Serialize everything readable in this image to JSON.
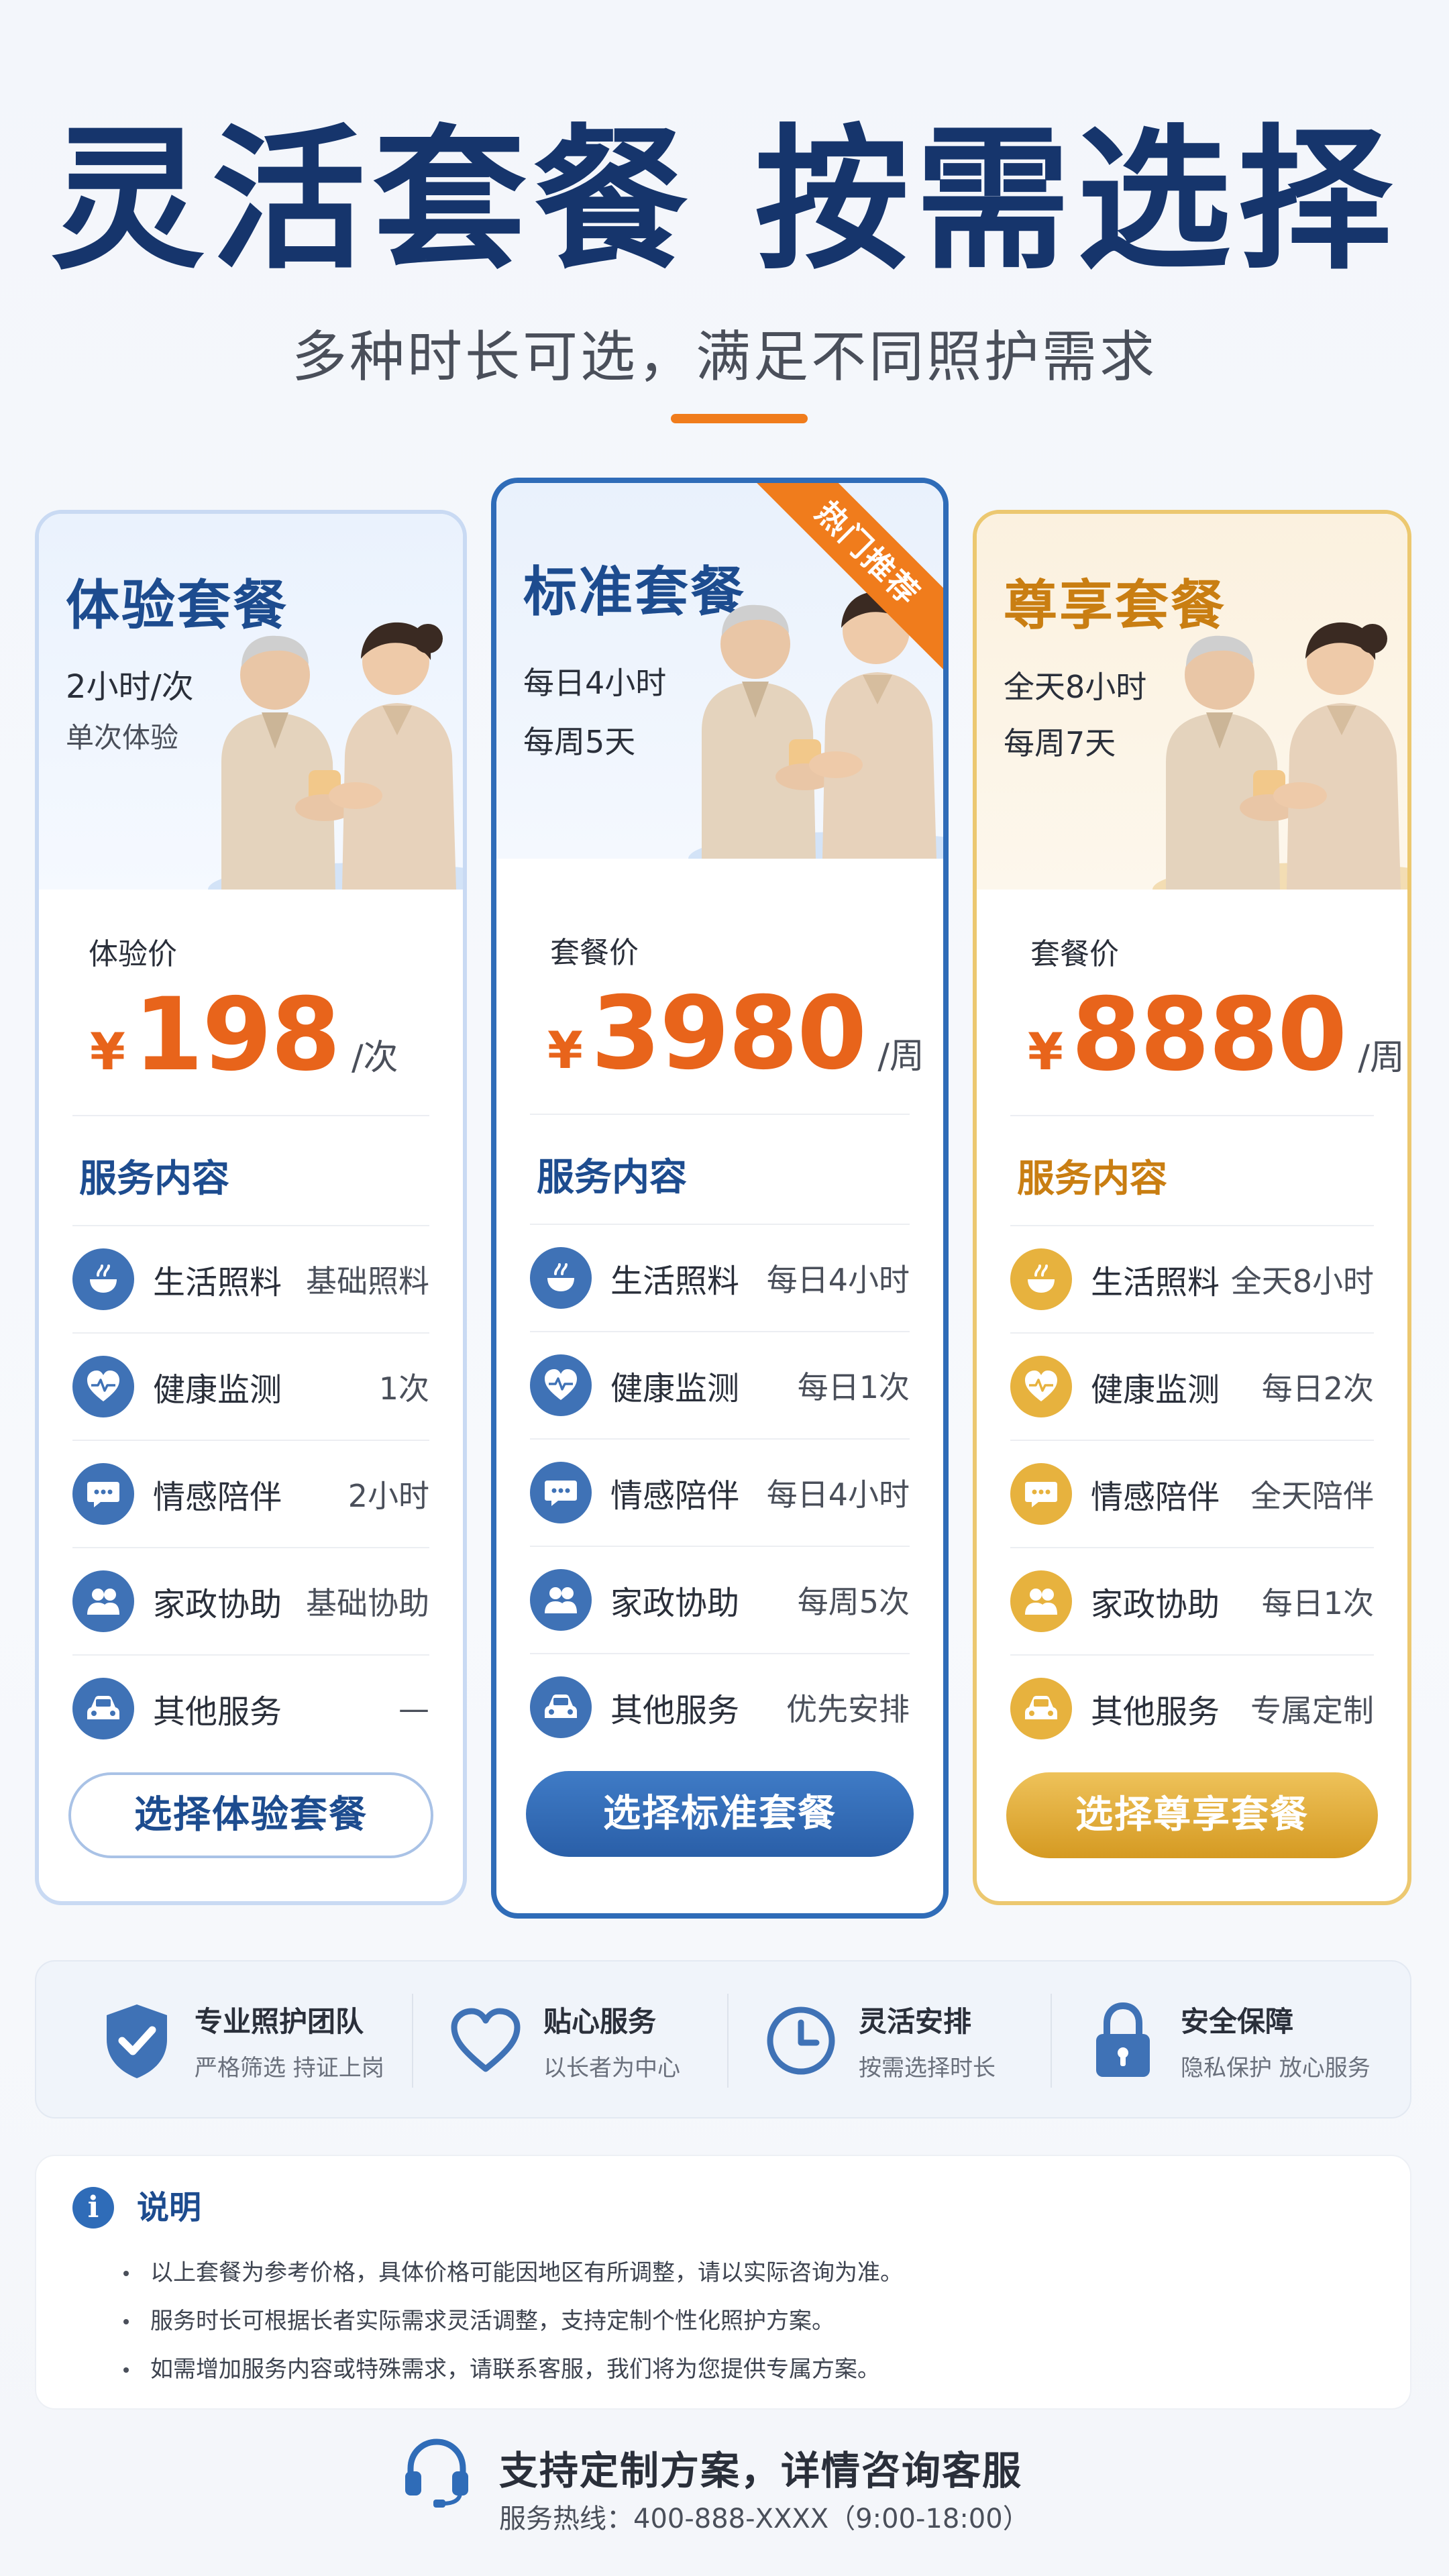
{
  "header": {
    "title": "灵活套餐 按需选择",
    "subtitle": "多种时长可选，满足不同照护需求"
  },
  "colors": {
    "primary_blue": "#1d4c8f",
    "accent_orange": "#e8641b",
    "gold": "#d59a22"
  },
  "plans": [
    {
      "name": "体验套餐",
      "line1": "2小时/次",
      "line2": "单次体验",
      "price_label": "体验价",
      "currency": "¥",
      "price": "198",
      "unit": "/次",
      "services_heading": "服务内容",
      "services": [
        {
          "icon": "meal-bowl-icon",
          "name": "生活照料",
          "value": "基础照料"
        },
        {
          "icon": "heart-pulse-icon",
          "name": "健康监测",
          "value": "1次"
        },
        {
          "icon": "chat-bubble-icon",
          "name": "情感陪伴",
          "value": "2小时"
        },
        {
          "icon": "people-icon",
          "name": "家政协助",
          "value": "基础协助"
        },
        {
          "icon": "car-icon",
          "name": "其他服务",
          "value": "—"
        }
      ],
      "button": "选择体验套餐"
    },
    {
      "name": "标准套餐",
      "ribbon": "热门推荐",
      "line1": "每日4小时",
      "line2": "每周5天",
      "price_label": "套餐价",
      "currency": "¥",
      "price": "3980",
      "unit": "/周",
      "services_heading": "服务内容",
      "services": [
        {
          "icon": "meal-bowl-icon",
          "name": "生活照料",
          "value": "每日4小时"
        },
        {
          "icon": "heart-pulse-icon",
          "name": "健康监测",
          "value": "每日1次"
        },
        {
          "icon": "chat-bubble-icon",
          "name": "情感陪伴",
          "value": "每日4小时"
        },
        {
          "icon": "people-icon",
          "name": "家政协助",
          "value": "每周5次"
        },
        {
          "icon": "car-icon",
          "name": "其他服务",
          "value": "优先安排"
        }
      ],
      "button": "选择标准套餐"
    },
    {
      "name": "尊享套餐",
      "line1": "全天8小时",
      "line2": "每周7天",
      "price_label": "套餐价",
      "currency": "¥",
      "price": "8880",
      "unit": "/周",
      "services_heading": "服务内容",
      "services": [
        {
          "icon": "meal-bowl-icon",
          "name": "生活照料",
          "value": "全天8小时"
        },
        {
          "icon": "heart-pulse-icon",
          "name": "健康监测",
          "value": "每日2次"
        },
        {
          "icon": "chat-bubble-icon",
          "name": "情感陪伴",
          "value": "全天陪伴"
        },
        {
          "icon": "people-icon",
          "name": "家政协助",
          "value": "每日1次"
        },
        {
          "icon": "car-icon",
          "name": "其他服务",
          "value": "专属定制"
        }
      ],
      "button": "选择尊享套餐"
    }
  ],
  "features": [
    {
      "icon": "shield-check-icon",
      "title": "专业照护团队",
      "desc": "严格筛选 持证上岗"
    },
    {
      "icon": "heart-outline-icon",
      "title": "贴心服务",
      "desc": "以长者为中心"
    },
    {
      "icon": "clock-icon",
      "title": "灵活安排",
      "desc": "按需选择时长"
    },
    {
      "icon": "lock-icon",
      "title": "安全保障",
      "desc": "隐私保护 放心服务"
    }
  ],
  "notes": {
    "icon": "info-icon",
    "title": "说明",
    "items": [
      "以上套餐为参考价格，具体价格可能因地区有所调整，请以实际咨询为准。",
      "服务时长可根据长者实际需求灵活调整，支持定制个性化照护方案。",
      "如需增加服务内容或特殊需求，请联系客服，我们将为您提供专属方案。"
    ]
  },
  "footer": {
    "icon": "headset-icon",
    "title": "支持定制方案，详情咨询客服",
    "hotline": "服务热线：400-888-XXXX（9:00-18:00）"
  }
}
